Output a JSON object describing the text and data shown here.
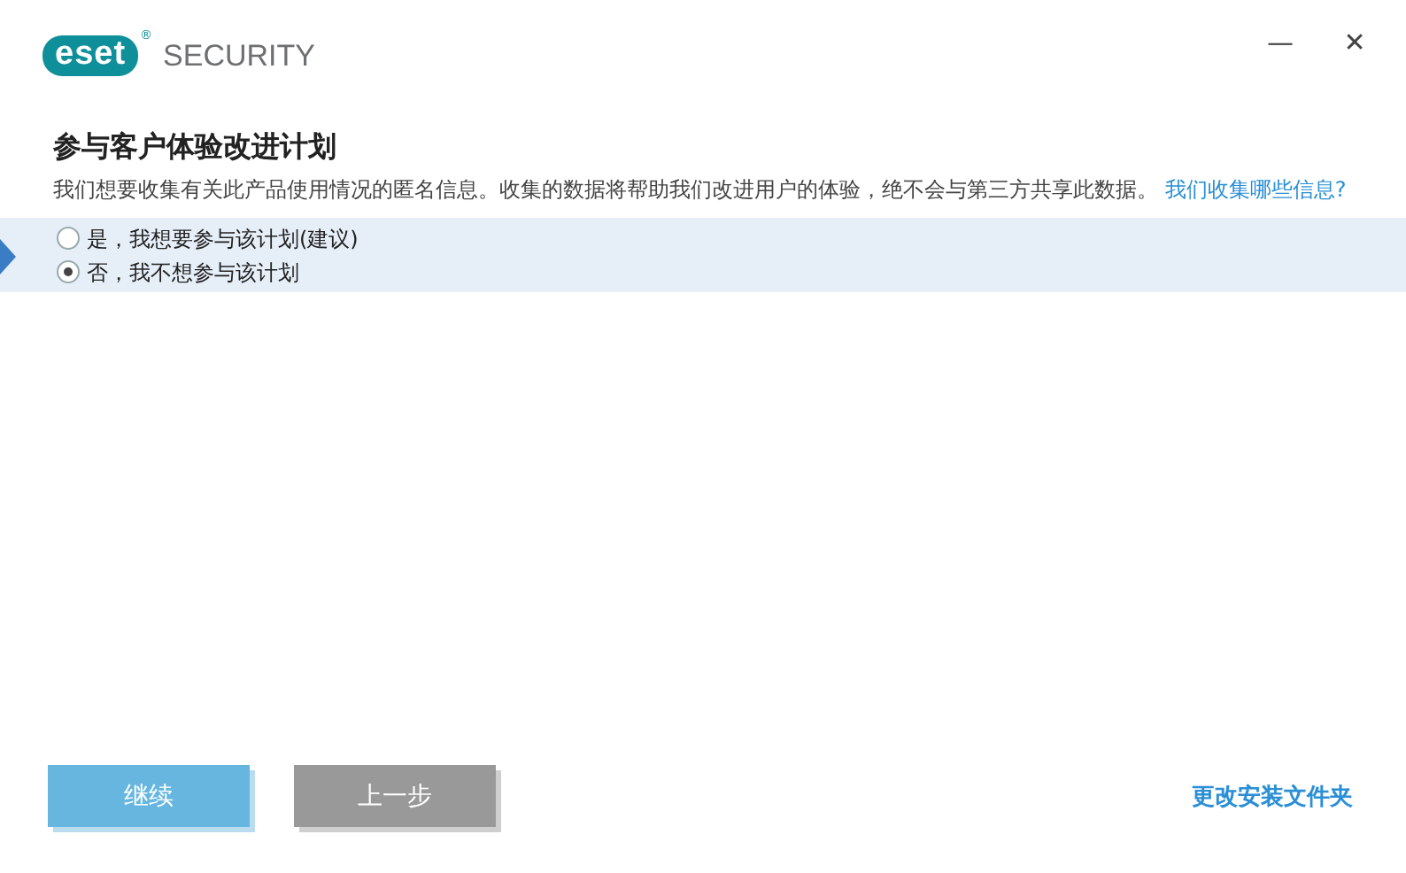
{
  "header": {
    "logo": "eset",
    "registered": "®",
    "product": "SECURITY",
    "minimize": "—",
    "close": "✕"
  },
  "title": "参与客户体验改进计划",
  "description": "我们想要收集有关此产品使用情况的匿名信息。收集的数据将帮助我们改进用户的体验，绝不会与第三方共享此数据。",
  "info_link": "我们收集哪些信息?",
  "options": [
    {
      "label": "是，我想要参与该计划(建议)",
      "selected": false
    },
    {
      "label": "否，我不想参与该计划",
      "selected": true
    }
  ],
  "buttons": [
    {
      "label": "继续",
      "kind": "primary"
    },
    {
      "label": "上一步",
      "kind": "secondary"
    }
  ],
  "folder_link": "更改安装文件夹"
}
